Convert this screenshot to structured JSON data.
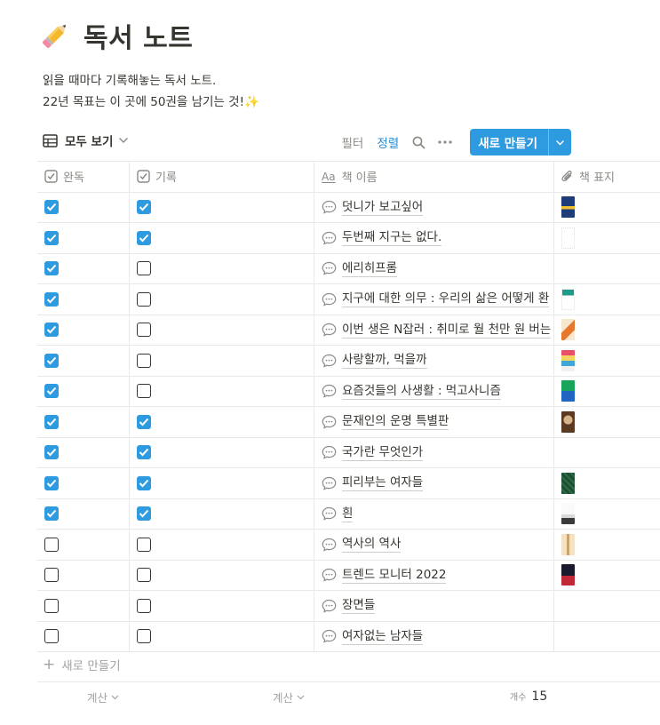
{
  "page": {
    "title": "독서 노트",
    "title_icon": "pencil-emoji",
    "description_line1": "읽을 때마다 기록해놓는 독서 노트.",
    "description_line2": "22년 목표는 이 곳에 50권을 남기는 것!",
    "sparkle": "✨"
  },
  "toolbar": {
    "view_label": "모두 보기",
    "filter_label": "필터",
    "sort_label": "정렬",
    "new_button_label": "새로 만들기"
  },
  "columns": {
    "done": "완독",
    "record": "기록",
    "name_prefix": "Aa",
    "name": "책 이름",
    "cover": "책 표지"
  },
  "rows": [
    {
      "done": true,
      "record": true,
      "name": "덧니가 보고싶어",
      "cover": "navy-blue-yellow"
    },
    {
      "done": true,
      "record": true,
      "name": "두번째 지구는 없다.",
      "cover": "white-minimal"
    },
    {
      "done": true,
      "record": false,
      "name": "에리히프롬",
      "cover": ""
    },
    {
      "done": true,
      "record": false,
      "name": "지구에 대한 의무 : 우리의 삶은 어떻게 환",
      "cover": "teal-white"
    },
    {
      "done": true,
      "record": false,
      "name": "이번 생은 N잡러 : 취미로 월 천만 원 버는",
      "cover": "orange-illustration"
    },
    {
      "done": true,
      "record": false,
      "name": "사랑할까, 먹을까",
      "cover": "colorful-food"
    },
    {
      "done": true,
      "record": false,
      "name": "요즘것들의 사생활 : 먹고사니즘",
      "cover": "green-blue"
    },
    {
      "done": true,
      "record": true,
      "name": "문재인의 운명 특별판",
      "cover": "portrait-brown"
    },
    {
      "done": true,
      "record": true,
      "name": "국가란 무엇인가",
      "cover": ""
    },
    {
      "done": true,
      "record": true,
      "name": "피리부는 여자들",
      "cover": "dark-green-pattern"
    },
    {
      "done": true,
      "record": true,
      "name": "흰",
      "cover": "white-grey"
    },
    {
      "done": false,
      "record": false,
      "name": "역사의 역사",
      "cover": "cream-portrait"
    },
    {
      "done": false,
      "record": false,
      "name": "트렌드 모니터 2022",
      "cover": "dark-red"
    },
    {
      "done": false,
      "record": false,
      "name": "장면들",
      "cover": ""
    },
    {
      "done": false,
      "record": false,
      "name": "여자없는 남자들",
      "cover": ""
    }
  ],
  "add_row_label": "새로 만들기",
  "footer": {
    "calc1": "계산",
    "calc2": "계산",
    "count_label": "개수",
    "count_value": "15"
  },
  "colors": {
    "accent": "#2e9ae0",
    "text": "#37352f",
    "muted": "#8b8a85",
    "border": "#e9e9e7"
  }
}
